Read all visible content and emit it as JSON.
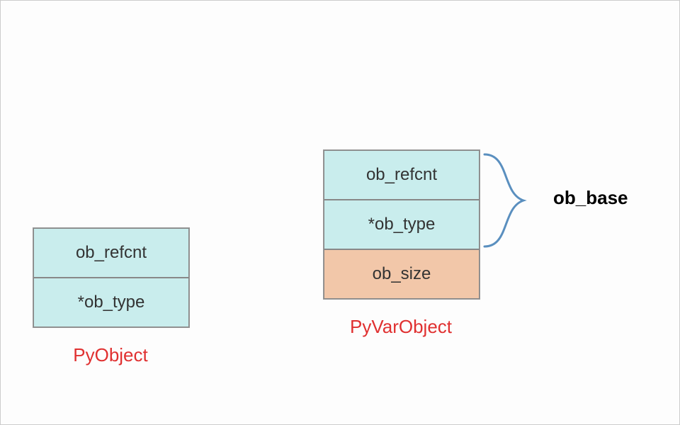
{
  "pyobject": {
    "title": "PyObject",
    "fields": {
      "refcnt": "ob_refcnt",
      "type": "*ob_type"
    }
  },
  "pyvarobject": {
    "title": "PyVarObject",
    "fields": {
      "refcnt": "ob_refcnt",
      "type": "*ob_type",
      "size": "ob_size"
    },
    "annotation": "ob_base"
  },
  "colors": {
    "blue_bg": "#c9eded",
    "peach_bg": "#f2c7a9",
    "label_red": "#e03030",
    "brace_stroke": "#5a8fbf"
  }
}
